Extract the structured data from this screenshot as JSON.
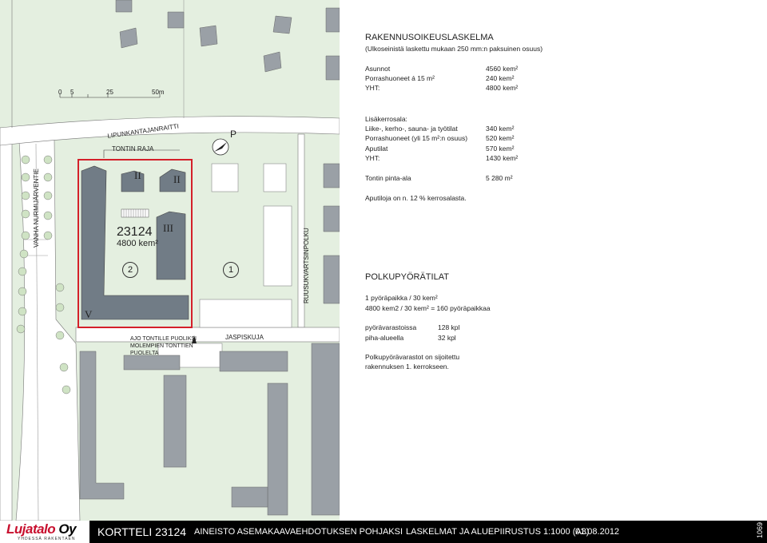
{
  "map": {
    "scale_labels": [
      "0",
      "5",
      "25",
      "50m"
    ],
    "streets": {
      "lipun": "LIPUNKANTAJANRAITTI",
      "vanha": "VANHA NURMIJÄRVENTIE",
      "ruusu": "RUUSUKVARTSINPOLKU",
      "jaspis": "JASPISKUJA"
    },
    "tontin_raja": "TONTIN RAJA",
    "block_number": "23124",
    "block_area": "4800 kem²",
    "floors": [
      "II",
      "II",
      "III",
      "V"
    ],
    "circles": [
      "2",
      "1"
    ],
    "north_label": "P",
    "ajo_note": [
      "AJO TONTILLE PUOLIKSI",
      "MOLEMPIEN TONTTIEN",
      "PUOLELTA"
    ]
  },
  "panel": {
    "title": "RAKENNUSOIKEUSLASKELMA",
    "subtitle": "(Ulkoseinistä laskettu mukaan 250 mm:n paksuinen osuus)",
    "rows1": [
      {
        "label": "Asunnot",
        "value": "4560 kem²"
      },
      {
        "label": "Porrashuoneet á 15 m²",
        "value": "240 kem²"
      },
      {
        "label": "YHT:",
        "value": "4800 kem²"
      }
    ],
    "extra_title": "Lisäkerrosala:",
    "rows2": [
      {
        "label": "Liike-, kerho-, sauna- ja työtilat",
        "value": "340 kem²"
      },
      {
        "label": "Porrashuoneet (yli 15 m²:n osuus)",
        "value": "520 kem²"
      },
      {
        "label": "Aputilat",
        "value": "570 kem²"
      },
      {
        "label": "YHT:",
        "value": "1430 kem²"
      }
    ],
    "pinta_label": "Tontin pinta-ala",
    "pinta_value": "5 280 m²",
    "aputiloja": "Aputiloja on n. 12 % kerrosalasta.",
    "polku_title": "POLKUPYÖRÄTILAT",
    "polku_l1": "1 pyöräpaikka / 30 kem²",
    "polku_l2": "4800 kem2 / 30 kem² = 160 pyöräpaikkaa",
    "rows3": [
      {
        "label": "pyörävarastoissa",
        "value": "128 kpl"
      },
      {
        "label": "piha-alueella",
        "value": "32 kpl"
      }
    ],
    "note1": "Polkupyörävarastot on sijoitettu",
    "note2": "rakennuksen 1. kerrokseen."
  },
  "footer": {
    "logo": "Lujatalo Oy",
    "logo_word1": "Lujatalo",
    "logo_word2": "Oy",
    "logo_sub": "YHDESSÄ RAKENTAEN",
    "kortteli": "KORTTELI 23124",
    "aineisto": "AINEISTO ASEMAKAAVAEHDOTUKSEN POHJAKSI",
    "laskelmat": "LASKELMAT JA ALUEPIIRUSTUS  1:1000 (A3)",
    "date": "01.08.2012",
    "number": "1069"
  },
  "colors": {
    "building": "#717c86",
    "green": "#e4efe0",
    "road": "#ffffff",
    "plot_border": "#d4202a",
    "footer_bg": "#000000",
    "logo_red": "#c8102e"
  }
}
